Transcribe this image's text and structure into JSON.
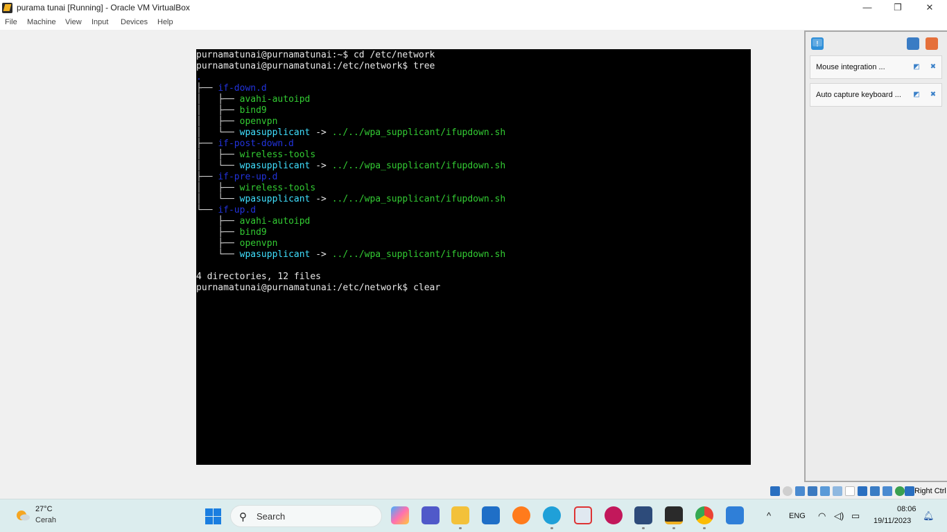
{
  "window": {
    "title": "purama tunai [Running] - Oracle VM VirtualBox",
    "controls": {
      "minimize": "—",
      "maximize": "❐",
      "close": "✕"
    }
  },
  "menu": [
    "File",
    "Machine",
    "View",
    "Input",
    "Devices",
    "Help"
  ],
  "terminal": {
    "lines": [
      {
        "segments": [
          {
            "t": "purnamatunai@purnamatunai:~$ cd /etc/network",
            "c": "white"
          }
        ]
      },
      {
        "segments": [
          {
            "t": "purnamatunai@purnamatunai:/etc/network$ tree",
            "c": "white"
          }
        ]
      },
      {
        "segments": [
          {
            "t": ".",
            "c": "dir"
          }
        ]
      },
      {
        "segments": [
          {
            "t": "├── ",
            "c": "tree"
          },
          {
            "t": "if-down.d",
            "c": "dir"
          }
        ]
      },
      {
        "segments": [
          {
            "t": "│   ├── ",
            "c": "tree"
          },
          {
            "t": "avahi-autoipd",
            "c": "file"
          }
        ]
      },
      {
        "segments": [
          {
            "t": "│   ├── ",
            "c": "tree"
          },
          {
            "t": "bind9",
            "c": "file"
          }
        ]
      },
      {
        "segments": [
          {
            "t": "│   ├── ",
            "c": "tree"
          },
          {
            "t": "openvpn",
            "c": "file"
          }
        ]
      },
      {
        "segments": [
          {
            "t": "│   └── ",
            "c": "tree"
          },
          {
            "t": "wpasupplicant",
            "c": "link"
          },
          {
            "t": " -> ",
            "c": "white"
          },
          {
            "t": "../../wpa_supplicant/ifupdown.sh",
            "c": "target"
          }
        ]
      },
      {
        "segments": [
          {
            "t": "├── ",
            "c": "tree"
          },
          {
            "t": "if-post-down.d",
            "c": "dir"
          }
        ]
      },
      {
        "segments": [
          {
            "t": "│   ├── ",
            "c": "tree"
          },
          {
            "t": "wireless-tools",
            "c": "file"
          }
        ]
      },
      {
        "segments": [
          {
            "t": "│   └── ",
            "c": "tree"
          },
          {
            "t": "wpasupplicant",
            "c": "link"
          },
          {
            "t": " -> ",
            "c": "white"
          },
          {
            "t": "../../wpa_supplicant/ifupdown.sh",
            "c": "target"
          }
        ]
      },
      {
        "segments": [
          {
            "t": "├── ",
            "c": "tree"
          },
          {
            "t": "if-pre-up.d",
            "c": "dir"
          }
        ]
      },
      {
        "segments": [
          {
            "t": "│   ├── ",
            "c": "tree"
          },
          {
            "t": "wireless-tools",
            "c": "file"
          }
        ]
      },
      {
        "segments": [
          {
            "t": "│   └── ",
            "c": "tree"
          },
          {
            "t": "wpasupplicant",
            "c": "link"
          },
          {
            "t": " -> ",
            "c": "white"
          },
          {
            "t": "../../wpa_supplicant/ifupdown.sh",
            "c": "target"
          }
        ]
      },
      {
        "segments": [
          {
            "t": "└── ",
            "c": "tree"
          },
          {
            "t": "if-up.d",
            "c": "dir"
          }
        ]
      },
      {
        "segments": [
          {
            "t": "    ├── ",
            "c": "tree"
          },
          {
            "t": "avahi-autoipd",
            "c": "file"
          }
        ]
      },
      {
        "segments": [
          {
            "t": "    ├── ",
            "c": "tree"
          },
          {
            "t": "bind9",
            "c": "file"
          }
        ]
      },
      {
        "segments": [
          {
            "t": "    ├── ",
            "c": "tree"
          },
          {
            "t": "openvpn",
            "c": "file"
          }
        ]
      },
      {
        "segments": [
          {
            "t": "    └── ",
            "c": "tree"
          },
          {
            "t": "wpasupplicant",
            "c": "link"
          },
          {
            "t": " -> ",
            "c": "white"
          },
          {
            "t": "../../wpa_supplicant/ifupdown.sh",
            "c": "target"
          }
        ]
      },
      {
        "segments": [
          {
            "t": "",
            "c": "white"
          }
        ]
      },
      {
        "segments": [
          {
            "t": "4 directories, 12 files",
            "c": "white"
          }
        ]
      },
      {
        "segments": [
          {
            "t": "purnamatunai@purnamatunai:/etc/network$ clear",
            "c": "white"
          }
        ]
      }
    ]
  },
  "notifications": [
    {
      "text": "Mouse integration ..."
    },
    {
      "text": "Auto capture keyboard ..."
    }
  ],
  "statusbar": {
    "host_key": "Right Ctrl"
  },
  "taskbar": {
    "weather": {
      "temp": "27°C",
      "desc": "Cerah"
    },
    "search_placeholder": "Search",
    "apps": [
      "copilot-icon",
      "teams-icon",
      "file-explorer-icon",
      "code-app-icon",
      "firefox-icon",
      "edge-icon",
      "snipping-tool-icon",
      "wps-office-icon",
      "virtualbox-icon",
      "running-vm-icon",
      "chrome-icon",
      "photos-icon"
    ],
    "tray": {
      "chevron": "^",
      "language": "ENG",
      "time": "08:06",
      "date": "19/11/2023"
    }
  }
}
